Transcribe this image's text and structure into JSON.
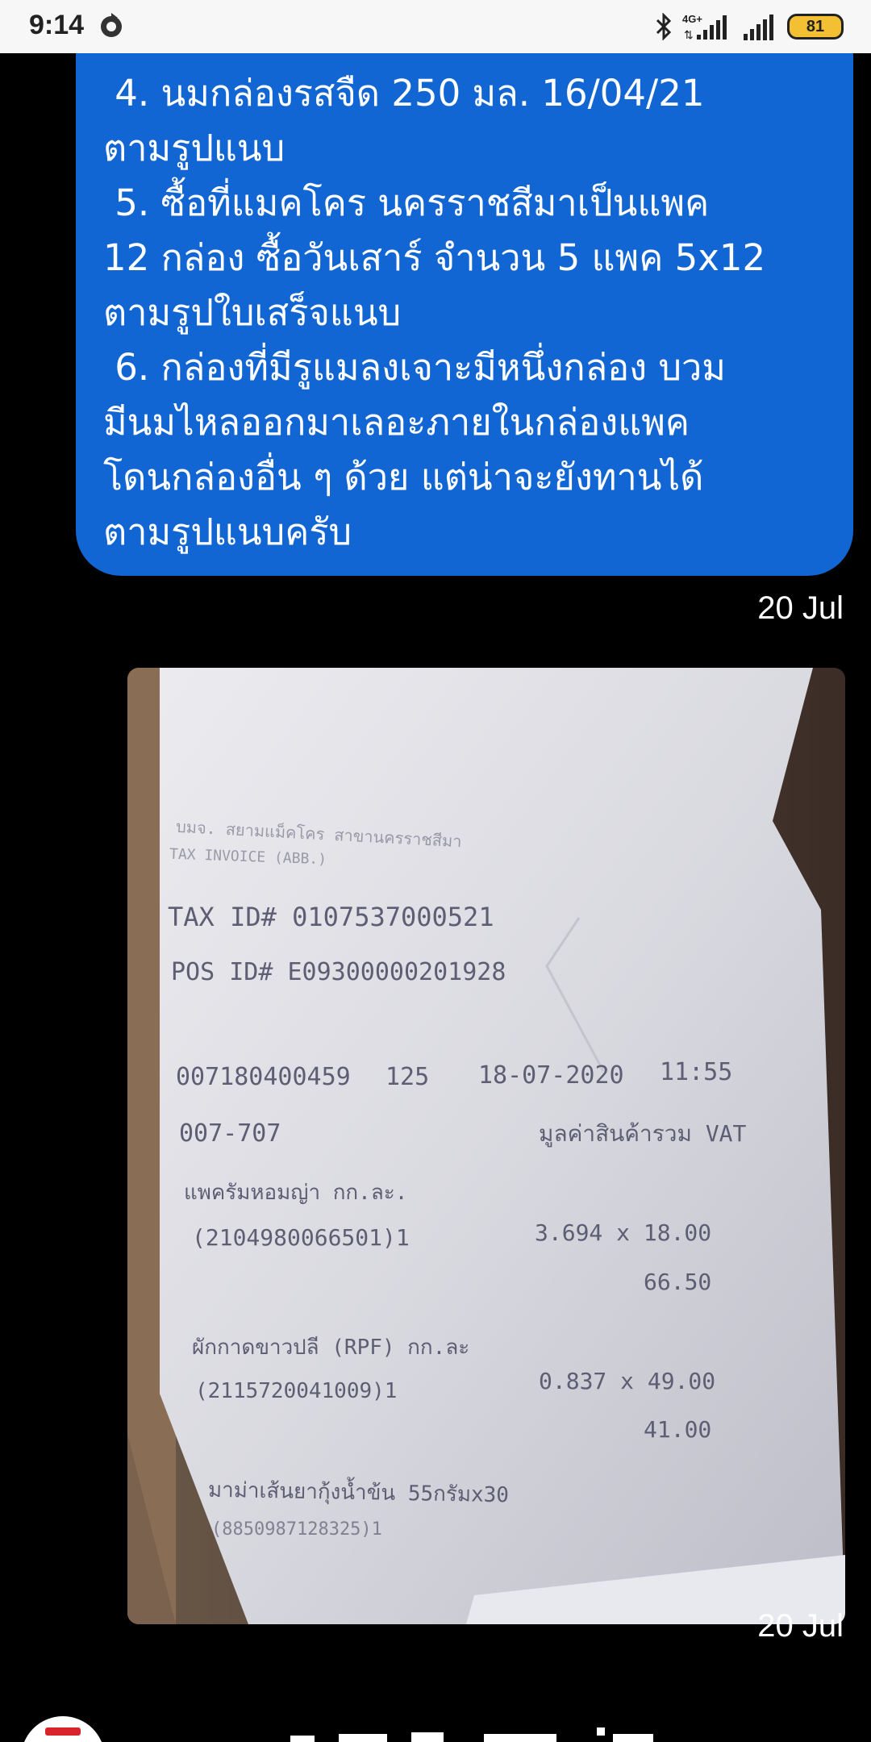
{
  "status_bar": {
    "time": "9:14",
    "network_label": "4G+",
    "battery": "81",
    "icons": [
      "sync-icon",
      "bluetooth-icon",
      "signal-4g-icon",
      "signal-icon",
      "battery-icon"
    ]
  },
  "message": {
    "lines": [
      " 4. นมกล่องรสจืด 250 มล. 16/04/21",
      "ตามรูปแนบ",
      " 5. ซื้อที่แมคโคร นครราชสีมาเป็นแพค",
      "12 กล่อง ซื้อวันเสาร์ จำนวน 5 แพค 5x12",
      "ตามรูปใบเสร็จแนบ",
      " 6. กล่องที่มีรูแมลงเจาะมีหนึ่งกล่อง บวม",
      "มีนมไหลออกมาเลอะภายในกล่องแพค",
      "โดนกล่องอื่น ๆ ด้วย แต่น่าจะยังทานได้",
      "ตามรูปแนบครับ"
    ],
    "timestamp": "20 Jul"
  },
  "photo_message": {
    "timestamp": "20 Jul",
    "receipt": {
      "header_line1": "บมจ. สยามแม็คโคร สาขานครราชสีมา",
      "header_line2": "TAX INVOICE (ABB.)",
      "tax_id": "TAX ID# 0107537000521",
      "pos_id": "POS ID# E09300000201928",
      "txn_no": "007180400459",
      "txn_code": "125",
      "date": "18-07-2020",
      "time": "11:55",
      "counter": "007-707",
      "vat_header": "มูลค่าสินค้ารวม VAT",
      "item1_name": "แพครัมหอมญ่า กก.ละ.",
      "item1_code": "(2104980066501)1",
      "item1_qty_price": "3.694 x 18.00",
      "item1_total": "66.50",
      "item2_name": "ผักกาดขาวปลี (RPF) กก.ละ",
      "item2_code": "(2115720041009)1",
      "item2_qty_price": "0.837 x 49.00",
      "item2_total": "41.00",
      "item3_name": "มาม่าเส้นยากุ้งน้ำข้น 55กรัมx30",
      "item3_code": "(8850987128325)1"
    }
  }
}
